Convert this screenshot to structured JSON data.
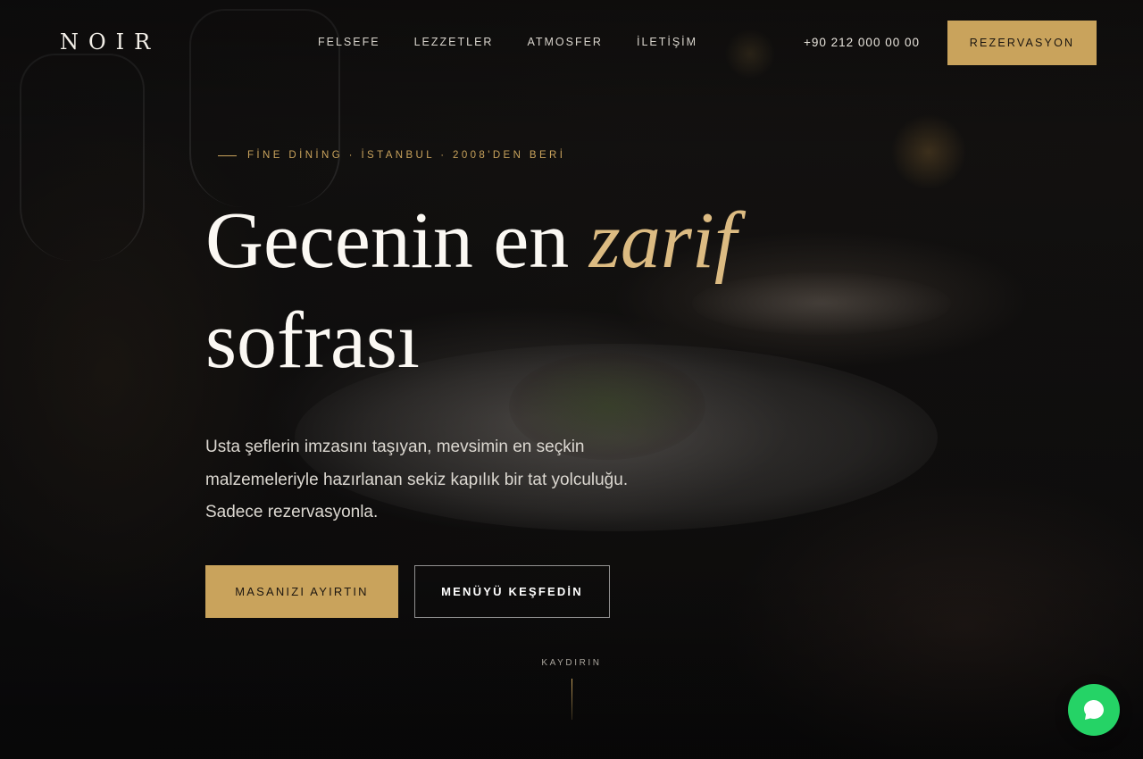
{
  "brand": {
    "logo": "NOIR"
  },
  "nav": {
    "items": [
      {
        "label": "FELSEFE"
      },
      {
        "label": "LEZZETLER"
      },
      {
        "label": "ATMOSFER"
      },
      {
        "label": "İLETİŞİM"
      }
    ],
    "phone": "+90 212 000 00 00",
    "reserve_label": "REZERVASYON"
  },
  "hero": {
    "eyebrow": "FİNE DİNİNG · İSTANBUL · 2008'DEN BERİ",
    "title_part1": "Gecenin en ",
    "title_highlight": "zarif",
    "title_part2": "sofrası",
    "lede": "Usta şeflerin imzasını taşıyan, mevsimin en seçkin malzemeleriyle hazırlanan sekiz kapılık bir tat yolculuğu. Sadece rezervasyonla.",
    "primary_cta": "MASANIZI AYIRTIN",
    "secondary_cta": "MENÜYÜ KEŞFEDİN",
    "scroll_label": "KAYDIRIN"
  },
  "colors": {
    "accent": "#c9a35c",
    "accent_light": "#dcbb82",
    "chat": "#25d366"
  },
  "icons": {
    "chat": "chat-bubble-icon"
  }
}
